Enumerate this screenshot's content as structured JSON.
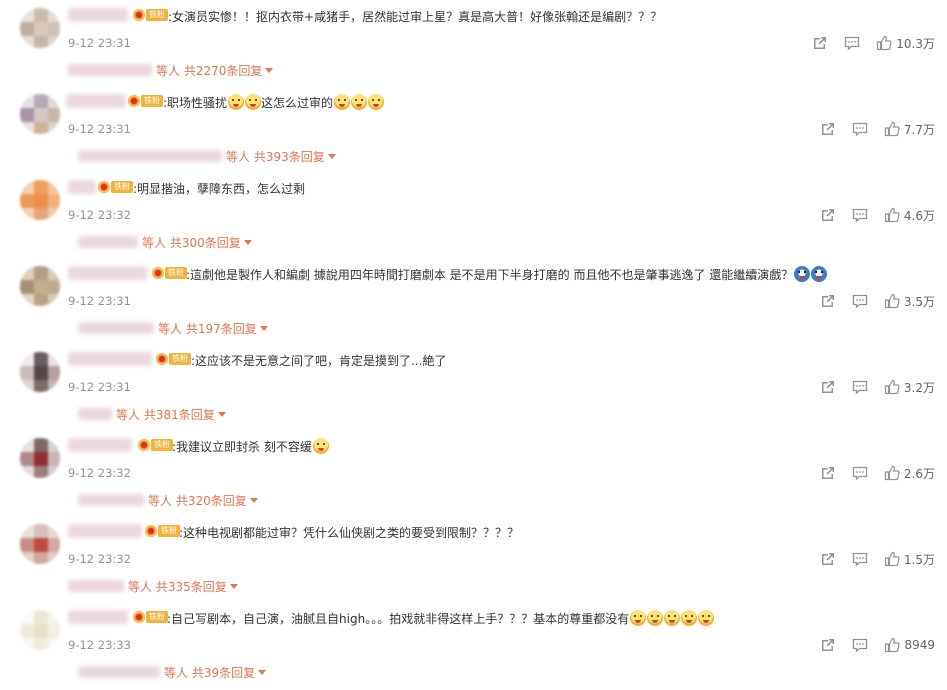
{
  "comments": [
    {
      "text": ":女演员实惨！！抠内衣带+咸猪手，居然能过审上星？真是高大普！好像张翰还是编剧？？？",
      "time": "9-12 23:31",
      "likes": "10.3万",
      "reply_text": "等人 共2270条回复",
      "badge": "铁粉",
      "emojis": []
    },
    {
      "text": ":职场性骚扰",
      "text2": "这怎么过审的",
      "time": "9-12 23:31",
      "likes": "7.7万",
      "reply_text": "等人 共393条回复",
      "badge": "铁粉",
      "emojis": [
        "sweat-face-icon",
        "sweat-face-icon"
      ],
      "emojis2": [
        "sweat-face-icon",
        "sweat-face-icon",
        "sweat-face-icon"
      ]
    },
    {
      "text": ":明显揩油，孽障东西，怎么过剩",
      "time": "9-12 23:32",
      "likes": "4.6万",
      "reply_text": "等人 共300条回复",
      "badge": "铁粉",
      "emojis": []
    },
    {
      "text": ":這劇他是製作人和編劇 據說用四年時間打磨劇本 是不是用下半身打磨的 而且他不也是肇事逃逸了 還能繼續演戲？",
      "time": "9-12 23:31",
      "likes": "3.5万",
      "reply_text": "等人 共197条回复",
      "badge": "铁粉",
      "emojis": [
        "doraemon-icon",
        "doraemon-icon"
      ]
    },
    {
      "text": ":这应该不是无意之间了吧，肯定是摸到了...絶了",
      "time": "9-12 23:31",
      "likes": "3.2万",
      "reply_text": "等人 共381条回复",
      "badge": "铁粉",
      "emojis": []
    },
    {
      "text": ":我建议立即封杀 刻不容缓",
      "time": "9-12 23:32",
      "likes": "2.6万",
      "reply_text": "等人 共320条回复",
      "badge": "铁粉",
      "emojis": [
        "crying-face-icon"
      ]
    },
    {
      "text": ":这种电视剧都能过审？凭什么仙侠剧之类的要受到限制？？？？",
      "time": "9-12 23:32",
      "likes": "1.5万",
      "reply_text": "等人 共335条回复",
      "badge": "铁粉",
      "emojis": []
    },
    {
      "text": ":自己写剧本，自己演，油腻且自high。。。拍戏就非得这样上手？？？基本的尊重都没有",
      "time": "9-12 23:33",
      "likes": "8949",
      "reply_text": "等人 共39条回复",
      "badge": "铁粉",
      "emojis": [
        "angry-face-icon",
        "angry-face-icon",
        "angry-face-icon",
        "angry-face-icon",
        "angry-face-icon"
      ]
    }
  ],
  "colors": {
    "accent": "#eb7350",
    "meta": "#939393",
    "text": "#333333"
  }
}
